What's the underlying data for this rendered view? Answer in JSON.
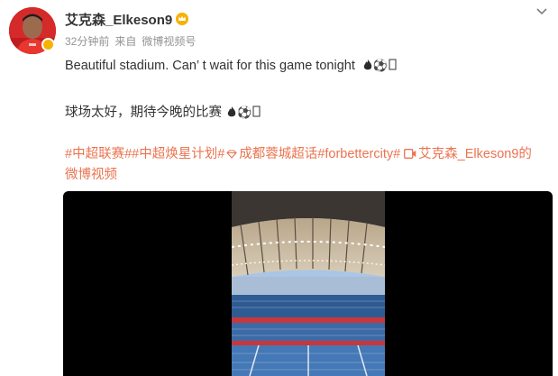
{
  "post": {
    "username": "艾克森_Elkeson9",
    "time": "32分钟前",
    "source_prefix": "来自",
    "source": "微博视频号",
    "text_en": "Beautiful stadium. Can’ t wait for this game tonight",
    "text_cn": "球场太好，期待今晚的比赛",
    "emoji_tail": "⚽",
    "tags": [
      "#中超联赛#",
      "#中超焕星计划#",
      "成都蓉城超话",
      "#forbettercity#"
    ],
    "video_link": "艾克森_Elkeson9的微博视频"
  },
  "colors": {
    "link": "#eb7350",
    "text": "#333333",
    "meta": "#939393",
    "video_bg": "#000000"
  },
  "icons": [
    "avatar",
    "crown-icon",
    "chevron-down-icon",
    "fire-icon",
    "soccer-ball-icon",
    "diamond-icon",
    "video-icon"
  ]
}
